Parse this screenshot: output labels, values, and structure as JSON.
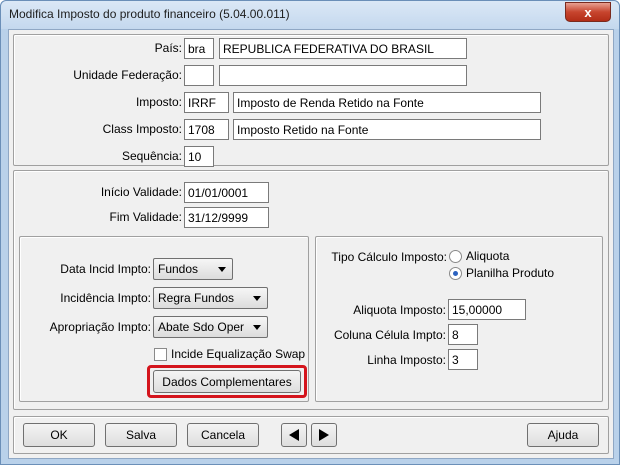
{
  "window": {
    "title": "Modifica Imposto do produto financeiro (5.04.00.011)",
    "close_label": "x"
  },
  "general": {
    "pais": {
      "label": "País:",
      "code": "bra",
      "name": "REPUBLICA FEDERATIVA DO BRASIL"
    },
    "uf": {
      "label": "Unidade Federação:",
      "code": "",
      "name": ""
    },
    "imposto": {
      "label": "Imposto:",
      "code": "IRRF",
      "name": "Imposto de Renda Retido na Fonte"
    },
    "class_imposto": {
      "label": "Class Imposto:",
      "code": "1708",
      "name": "Imposto Retido na Fonte"
    },
    "sequencia": {
      "label": "Sequência:",
      "value": "10"
    }
  },
  "validity": {
    "inicio": {
      "label": "Início Validade:",
      "value": "01/01/0001"
    },
    "fim": {
      "label": "Fim Validade:",
      "value": "31/12/9999"
    }
  },
  "left_panel": {
    "data_incid": {
      "label": "Data Incid Impto:",
      "value": "Fundos"
    },
    "incidencia": {
      "label": "Incidência Impto:",
      "value": "Regra Fundos"
    },
    "apropriacao": {
      "label": "Apropriação Impto:",
      "value": "Abate Sdo Oper"
    },
    "equalizacao": {
      "label": "Incide Equalização Swap",
      "checked": false
    },
    "dados_button": "Dados Complementares"
  },
  "right_panel": {
    "tipo_calculo": {
      "label": "Tipo Cálculo Imposto:",
      "options": [
        "Aliquota",
        "Planilha Produto"
      ],
      "selected": "Planilha Produto"
    },
    "aliquota": {
      "label": "Aliquota Imposto:",
      "value": "15,00000"
    },
    "coluna": {
      "label": "Coluna Célula Impto:",
      "value": "8"
    },
    "linha": {
      "label": "Linha Imposto:",
      "value": "3"
    }
  },
  "footer": {
    "ok": "OK",
    "salva": "Salva",
    "cancela": "Cancela",
    "ajuda": "Ajuda"
  },
  "colors": {
    "highlight": "#d4141c",
    "radio_selected": "#2b62c0"
  }
}
